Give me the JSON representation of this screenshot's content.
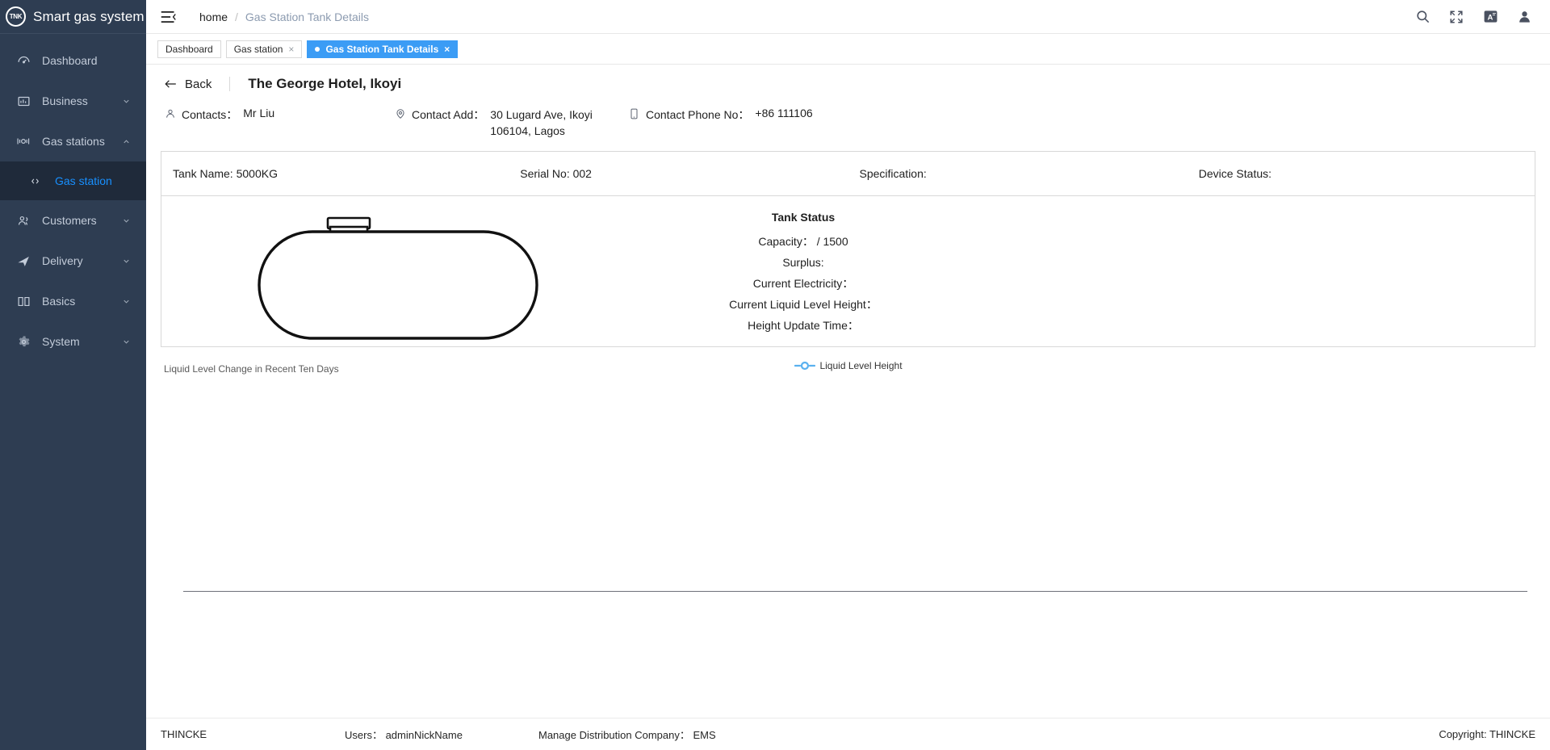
{
  "brand": {
    "logo_text": "TNK",
    "logo_icon": "tank-logo-icon",
    "title": "Smart gas system"
  },
  "sidebar": {
    "items": [
      {
        "label": "Dashboard",
        "icon": "dashboard-icon",
        "has_caret": false,
        "expanded": false
      },
      {
        "label": "Business",
        "icon": "business-icon",
        "has_caret": true,
        "expanded": false
      },
      {
        "label": "Gas stations",
        "icon": "gas-station-icon",
        "has_caret": true,
        "expanded": true
      },
      {
        "label": "Customers",
        "icon": "customers-icon",
        "has_caret": true,
        "expanded": false
      },
      {
        "label": "Delivery",
        "icon": "delivery-icon",
        "has_caret": true,
        "expanded": false
      },
      {
        "label": "Basics",
        "icon": "book-icon",
        "has_caret": true,
        "expanded": false
      },
      {
        "label": "System",
        "icon": "gear-icon",
        "has_caret": true,
        "expanded": false
      }
    ],
    "sub_item": {
      "label": "Gas station",
      "icon": "code-brackets-icon",
      "active": true
    },
    "active_color": "#1890ff",
    "background": "#2e3d52"
  },
  "topbar": {
    "menu_icon": "hamburger-menu-icon",
    "breadcrumb": {
      "root": "home",
      "separator": "/",
      "current": "Gas Station Tank Details"
    },
    "actions": [
      {
        "name": "search-icon",
        "label": "Search"
      },
      {
        "name": "fullscreen-icon",
        "label": "Fullscreen"
      },
      {
        "name": "language-icon",
        "label": "Language"
      },
      {
        "name": "user-avatar-icon",
        "label": "Account"
      }
    ]
  },
  "tabs": {
    "items": [
      {
        "label": "Dashboard",
        "closable": false,
        "active": false
      },
      {
        "label": "Gas station",
        "closable": true,
        "active": false
      },
      {
        "label": "Gas Station Tank Details",
        "closable": true,
        "active": true
      }
    ],
    "close_glyph": "×",
    "active_color": "#3b9cf5"
  },
  "page": {
    "back_label": "Back",
    "back_icon": "arrow-left-icon",
    "title": "The George Hotel, Ikoyi",
    "contacts": {
      "label": "Contacts：",
      "value": "Mr Liu",
      "icon": "person-icon"
    },
    "address": {
      "label": "Contact Add：",
      "value": "30 Lugard Ave, Ikoyi 106104, Lagos",
      "icon": "location-pin-icon"
    },
    "phone": {
      "label": "Contact Phone No：",
      "value": "+86 111106",
      "icon": "mobile-phone-icon"
    }
  },
  "tank_card": {
    "header": [
      {
        "label": "Tank Name:",
        "value": "5000KG"
      },
      {
        "label": "Serial No:",
        "value": "002"
      },
      {
        "label": "Specification:",
        "value": ""
      },
      {
        "label": "Device Status:",
        "value": ""
      }
    ],
    "tank_graphic": "horizontal-capsule-tank-with-hatch",
    "status": {
      "title": "Tank Status",
      "rows": [
        {
          "label": "Capacity：",
          "value": "/ 1500"
        },
        {
          "label": "Surplus:",
          "value": ""
        },
        {
          "label": "Current Electricity：",
          "value": ""
        },
        {
          "label": "Current Liquid Level Height：",
          "value": ""
        },
        {
          "label": "Height Update Time：",
          "value": ""
        }
      ]
    }
  },
  "chart_data": {
    "type": "line",
    "title": "Liquid Level Change in Recent Ten Days",
    "xlabel": "",
    "ylabel": "",
    "categories": [],
    "series": [
      {
        "name": "Liquid Level Height",
        "values": [],
        "color": "#5ab1ef",
        "marker": "hollow-circle"
      }
    ],
    "legend": {
      "position": "top-center",
      "entries": [
        "Liquid Level Height"
      ]
    },
    "grid": false,
    "has_data": false,
    "axis_color": "#6e7079"
  },
  "footer": {
    "brand": "THINCKE",
    "users_label": "Users：",
    "users_value": "adminNickName",
    "company_label": "Manage Distribution Company：",
    "company_value": "EMS",
    "copyright": "Copyright: THINCKE"
  }
}
